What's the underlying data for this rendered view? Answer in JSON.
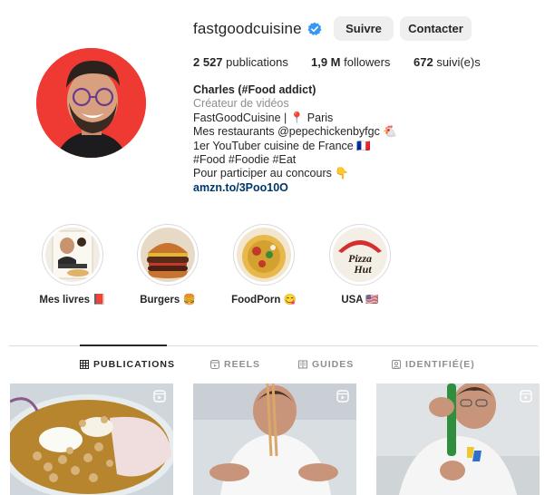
{
  "profile": {
    "username": "fastgoodcuisine",
    "follow_label": "Suivre",
    "contact_label": "Contacter",
    "stats": {
      "posts_count": "2 527",
      "posts_label": "publications",
      "followers_count": "1,9 M",
      "followers_label": "followers",
      "following_count": "672",
      "following_label": "suivi(e)s"
    },
    "bio": {
      "name": "Charles (#Food addict)",
      "category": "Créateur de vidéos",
      "lines": [
        "FastGoodCuisine | 📍 Paris",
        "Mes restaurants @pepechickenbyfgc 🐔",
        "1er YouTuber cuisine de France 🇫🇷",
        "#Food #Foodie #Eat",
        "Pour participer au concours 👇"
      ],
      "link": "amzn.to/3Poo10O"
    }
  },
  "highlights": [
    {
      "label": "Mes livres 📕",
      "icon": "book-cover"
    },
    {
      "label": "Burgers 🍔",
      "icon": "burger"
    },
    {
      "label": "FoodPorn 😋",
      "icon": "pizza-fries"
    },
    {
      "label": "USA 🇺🇸",
      "icon": "pizza-hut-logo",
      "logo_text": "Pizza Hut"
    }
  ],
  "tabs": [
    {
      "label": "PUBLICATIONS",
      "icon": "grid-icon",
      "active": true
    },
    {
      "label": "REELS",
      "icon": "reels-icon",
      "active": false
    },
    {
      "label": "GUIDES",
      "icon": "guides-icon",
      "active": false
    },
    {
      "label": "IDENTIFIÉ(E)",
      "icon": "tagged-icon",
      "active": false
    }
  ],
  "posts": [
    {
      "type": "reel",
      "subject": "dessert bowl with nuts"
    },
    {
      "type": "reel",
      "subject": "man with chopsticks"
    },
    {
      "type": "reel",
      "subject": "man with green bottle"
    }
  ],
  "colors": {
    "verified": "#3897f0",
    "avatar_bg": "#ef3a33",
    "link": "#00376b",
    "muted": "#8e8e8e",
    "button_bg": "#efefef"
  }
}
